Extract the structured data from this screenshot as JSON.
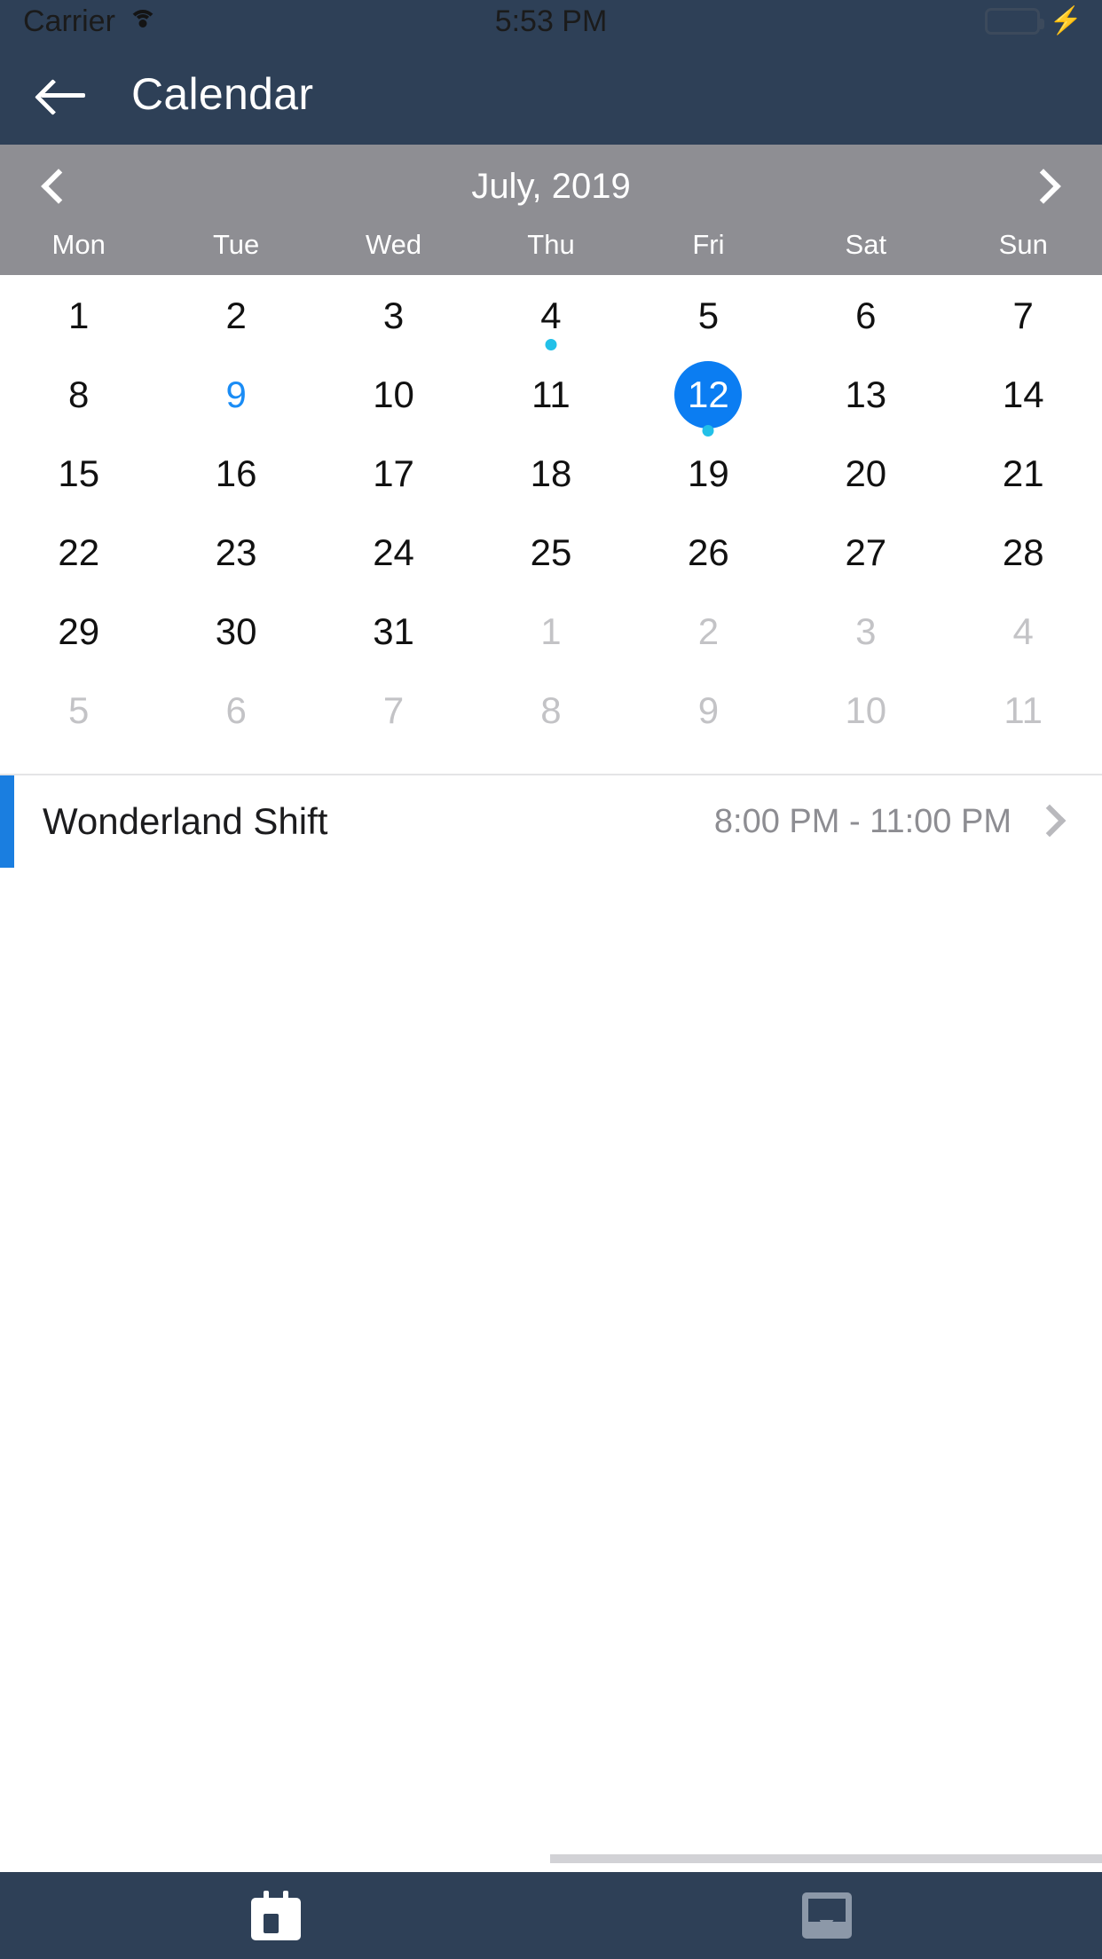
{
  "status_bar": {
    "carrier": "Carrier",
    "time": "5:53 PM",
    "wifi_icon": "wifi-icon",
    "battery_icon": "battery-full-icon",
    "charging_icon": "lightning-bolt-icon",
    "battery_color": "#46e061"
  },
  "header": {
    "title": "Calendar",
    "back_icon": "back-arrow-icon",
    "background_color": "#2e4057"
  },
  "calendar": {
    "month_label": "July, 2019",
    "prev_icon": "chevron-left-icon",
    "next_icon": "chevron-right-icon",
    "header_background": "#8e8e93",
    "weekdays": [
      "Mon",
      "Tue",
      "Wed",
      "Thu",
      "Fri",
      "Sat",
      "Sun"
    ],
    "selected_color": "#0b7df2",
    "event_dot_color": "#22c0e8",
    "accent_day_color": "#1a8cf5",
    "weeks": [
      [
        {
          "day": "1",
          "state": "normal",
          "dot": false
        },
        {
          "day": "2",
          "state": "normal",
          "dot": false
        },
        {
          "day": "3",
          "state": "normal",
          "dot": false
        },
        {
          "day": "4",
          "state": "normal",
          "dot": true
        },
        {
          "day": "5",
          "state": "normal",
          "dot": false
        },
        {
          "day": "6",
          "state": "normal",
          "dot": false
        },
        {
          "day": "7",
          "state": "normal",
          "dot": false
        }
      ],
      [
        {
          "day": "8",
          "state": "normal",
          "dot": false
        },
        {
          "day": "9",
          "state": "accent",
          "dot": false
        },
        {
          "day": "10",
          "state": "normal",
          "dot": false
        },
        {
          "day": "11",
          "state": "normal",
          "dot": false
        },
        {
          "day": "12",
          "state": "selected",
          "dot": true
        },
        {
          "day": "13",
          "state": "normal",
          "dot": false
        },
        {
          "day": "14",
          "state": "normal",
          "dot": false
        }
      ],
      [
        {
          "day": "15",
          "state": "normal",
          "dot": false
        },
        {
          "day": "16",
          "state": "normal",
          "dot": false
        },
        {
          "day": "17",
          "state": "normal",
          "dot": false
        },
        {
          "day": "18",
          "state": "normal",
          "dot": false
        },
        {
          "day": "19",
          "state": "normal",
          "dot": false
        },
        {
          "day": "20",
          "state": "normal",
          "dot": false
        },
        {
          "day": "21",
          "state": "normal",
          "dot": false
        }
      ],
      [
        {
          "day": "22",
          "state": "normal",
          "dot": false
        },
        {
          "day": "23",
          "state": "normal",
          "dot": false
        },
        {
          "day": "24",
          "state": "normal",
          "dot": false
        },
        {
          "day": "25",
          "state": "normal",
          "dot": false
        },
        {
          "day": "26",
          "state": "normal",
          "dot": false
        },
        {
          "day": "27",
          "state": "normal",
          "dot": false
        },
        {
          "day": "28",
          "state": "normal",
          "dot": false
        }
      ],
      [
        {
          "day": "29",
          "state": "normal",
          "dot": false
        },
        {
          "day": "30",
          "state": "normal",
          "dot": false
        },
        {
          "day": "31",
          "state": "normal",
          "dot": false
        },
        {
          "day": "1",
          "state": "muted",
          "dot": false
        },
        {
          "day": "2",
          "state": "muted",
          "dot": false
        },
        {
          "day": "3",
          "state": "muted",
          "dot": false
        },
        {
          "day": "4",
          "state": "muted",
          "dot": false
        }
      ],
      [
        {
          "day": "5",
          "state": "muted",
          "dot": false
        },
        {
          "day": "6",
          "state": "muted",
          "dot": false
        },
        {
          "day": "7",
          "state": "muted",
          "dot": false
        },
        {
          "day": "8",
          "state": "muted",
          "dot": false
        },
        {
          "day": "9",
          "state": "muted",
          "dot": false
        },
        {
          "day": "10",
          "state": "muted",
          "dot": false
        },
        {
          "day": "11",
          "state": "muted",
          "dot": false
        }
      ]
    ]
  },
  "events": [
    {
      "title": "Wonderland Shift",
      "time": "8:00 PM - 11:00 PM",
      "accent_color": "#1a7ee0",
      "chevron_icon": "chevron-right-icon"
    }
  ],
  "tabbar": {
    "background_color": "#2e4057",
    "tabs": [
      {
        "icon": "calendar-icon",
        "active": true
      },
      {
        "icon": "inbox-tray-icon",
        "active": false
      }
    ]
  }
}
